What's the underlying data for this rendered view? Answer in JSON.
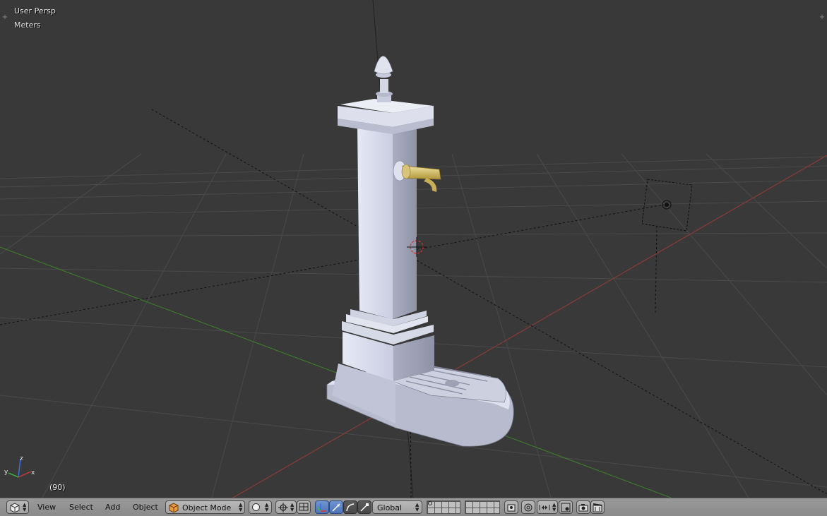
{
  "viewport": {
    "view_name": "User Persp",
    "units": "Meters",
    "frame": "(90)",
    "axis_labels": {
      "x": "x",
      "y": "y",
      "z": "z"
    }
  },
  "header": {
    "menus": [
      "View",
      "Select",
      "Add",
      "Object"
    ],
    "mode": "Object Mode",
    "orientation": "Global"
  },
  "colors": {
    "background": "#393939",
    "grid": "#4a4a4a",
    "x_axis": "#8a3a3a",
    "y_axis": "#3c7a2c",
    "header": "#959595",
    "active_toggle": "#5680c2"
  },
  "icons": [
    "editor-type-icon",
    "object-mode-cube-icon",
    "viewport-shading-icon",
    "pivot-point-icon",
    "manipulator-icon",
    "translate-manipulator-icon",
    "rotate-manipulator-icon",
    "scale-manipulator-icon",
    "layers-icon",
    "lock-camera-icon",
    "proportional-edit-icon",
    "snap-icon",
    "render-icon",
    "render-animation-icon"
  ]
}
